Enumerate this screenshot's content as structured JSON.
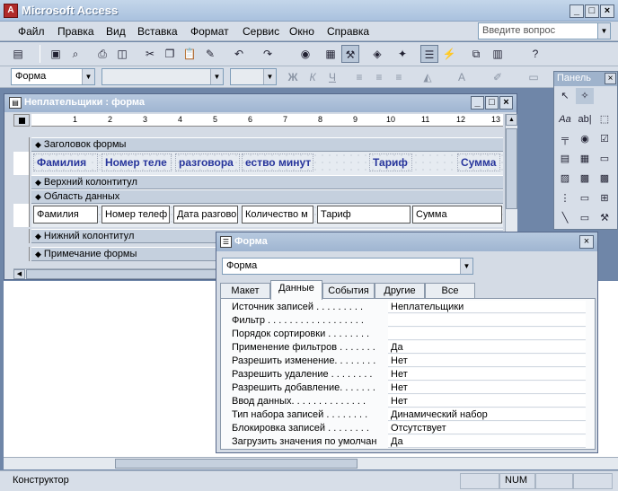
{
  "app": {
    "title": "Microsoft Access"
  },
  "menu": {
    "items": [
      "Файл",
      "Правка",
      "Вид",
      "Вставка",
      "Формат",
      "Сервис",
      "Окно",
      "Справка"
    ],
    "help_placeholder": "Введите вопрос"
  },
  "toolbar2": {
    "object_combo": "Форма"
  },
  "toolbox": {
    "title": "Панель"
  },
  "design_window": {
    "title": "Неплательщики : форма",
    "ruler_marks": [
      "1",
      "2",
      "3",
      "4",
      "5",
      "6",
      "7",
      "8",
      "9",
      "10",
      "11",
      "12",
      "13"
    ],
    "sections": {
      "header": "Заголовок формы",
      "page_header": "Верхний колонтитул",
      "detail": "Область данных",
      "page_footer": "Нижний колонтитул",
      "footer": "Примечание формы"
    },
    "header_labels": [
      "Фамилия",
      "Номер теле",
      "разговора",
      "ество минут",
      "Тариф",
      "Сумма"
    ],
    "detail_fields": [
      "Фамилия",
      "Номер телеф",
      "Дата разгово",
      "Количество м",
      "Тариф",
      "Сумма"
    ]
  },
  "props": {
    "title": "Форма",
    "object": "Форма",
    "tabs": [
      "Макет",
      "Данные",
      "События",
      "Другие",
      "Все"
    ],
    "active_tab": "Данные",
    "rows": [
      {
        "name": "Источник записей . . . . . . . . .",
        "value": "Неплательщики"
      },
      {
        "name": "Фильтр . . . . . . . . . . . . . . . . . .",
        "value": ""
      },
      {
        "name": "Порядок сортировки . . . . . . . .",
        "value": ""
      },
      {
        "name": "Применение фильтров . . . . . . .",
        "value": "Да"
      },
      {
        "name": "Разрешить изменение. . . . . . . .",
        "value": "Нет"
      },
      {
        "name": "Разрешить удаление . . . . . . . .",
        "value": "Нет"
      },
      {
        "name": "Разрешить добавление. . . . . . .",
        "value": "Нет"
      },
      {
        "name": "Ввод данных. . . . . . . . . . . . . .",
        "value": "Нет"
      },
      {
        "name": "Тип набора записей . . . . . . . .",
        "value": "Динамический набор"
      },
      {
        "name": "Блокировка записей . . . . . . . .",
        "value": "Отсутствует"
      },
      {
        "name": "Загрузить значения по умолчан",
        "value": "Да"
      }
    ]
  },
  "status": {
    "mode": "Конструктор",
    "num": "NUM"
  }
}
